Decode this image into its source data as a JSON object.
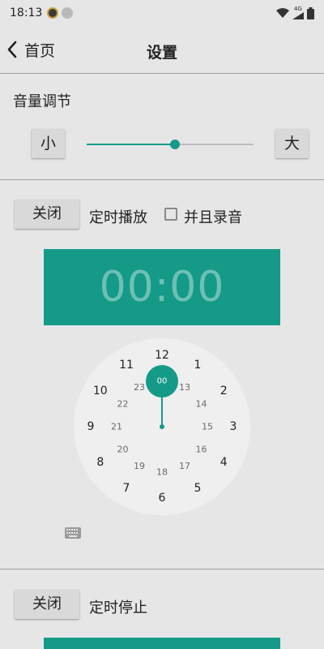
{
  "status_bar": {
    "time": "18:13",
    "network_label": "4G"
  },
  "header": {
    "back_label": "首页",
    "title": "设置"
  },
  "volume": {
    "label": "音量调节",
    "min_label": "小",
    "max_label": "大",
    "level": 0.53
  },
  "timer_play": {
    "toggle_label": "关闭",
    "label": "定时播放",
    "record_label": "并且录音",
    "record_checked": false,
    "time_display": "00:00"
  },
  "clock_face": {
    "selected": "00",
    "outer_numbers": [
      "12",
      "1",
      "2",
      "3",
      "4",
      "5",
      "6",
      "7",
      "8",
      "9",
      "10",
      "11"
    ],
    "inner_numbers": [
      "13",
      "14",
      "15",
      "16",
      "17",
      "18",
      "19",
      "20",
      "21",
      "22",
      "23"
    ]
  },
  "timer_stop": {
    "toggle_label": "关闭",
    "label": "定时停止"
  },
  "colors": {
    "accent": "#159a88",
    "background": "#e6e6e6",
    "clock_face": "#efefef",
    "button": "#d9d9d9"
  },
  "icons": [
    "back-chevron-icon",
    "keyboard-icon",
    "wifi-icon",
    "battery-icon"
  ]
}
